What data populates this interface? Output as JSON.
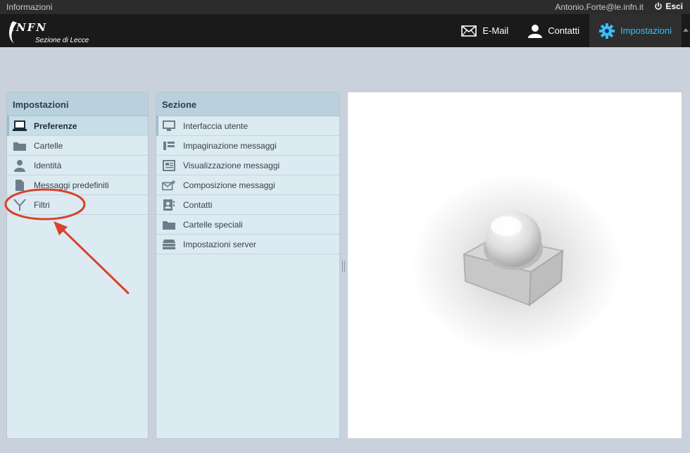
{
  "topbar": {
    "info": "Informazioni",
    "user": "Antonio.Forte@le.infn.it",
    "logout": "Esci"
  },
  "logo": {
    "brand": "INFN",
    "subtitle": "Sezione di Lecce"
  },
  "nav": {
    "email": "E-Mail",
    "contacts": "Contatti",
    "settings": "Impostazioni"
  },
  "settings_panel": {
    "title": "Impostazioni",
    "items": [
      {
        "label": "Preferenze",
        "icon": "laptop-icon"
      },
      {
        "label": "Cartelle",
        "icon": "folder-icon"
      },
      {
        "label": "Identità",
        "icon": "person-icon"
      },
      {
        "label": "Messaggi predefiniti",
        "icon": "document-icon"
      },
      {
        "label": "Filtri",
        "icon": "filter-icon"
      }
    ]
  },
  "section_panel": {
    "title": "Sezione",
    "items": [
      {
        "label": "Interfaccia utente",
        "icon": "monitor-icon"
      },
      {
        "label": "Impaginazione messaggi",
        "icon": "layout-icon"
      },
      {
        "label": "Visualizzazione messaggi",
        "icon": "message-view-icon"
      },
      {
        "label": "Composizione messaggi",
        "icon": "compose-icon"
      },
      {
        "label": "Contatti",
        "icon": "contact-card-icon"
      },
      {
        "label": "Cartelle speciali",
        "icon": "folder-icon"
      },
      {
        "label": "Impostazioni server",
        "icon": "server-icon"
      }
    ]
  },
  "colors": {
    "accent": "#37beff",
    "annotation": "#d9412b",
    "panel_bg": "#dceaf2",
    "panel_header": "#b8d1dc"
  }
}
